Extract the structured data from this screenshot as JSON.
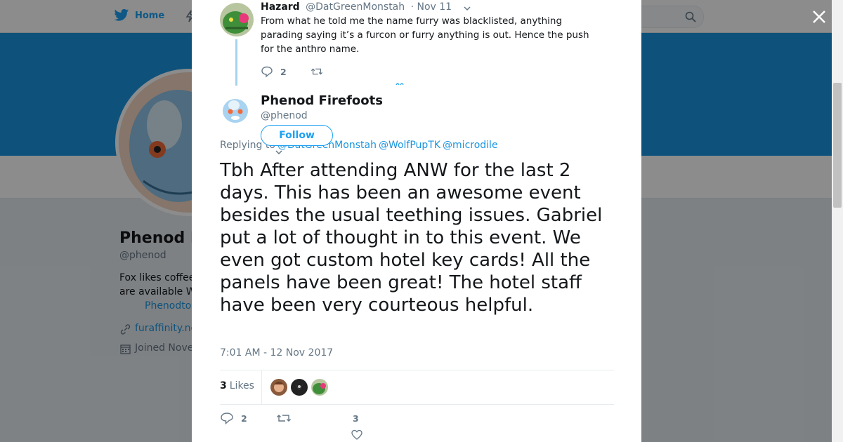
{
  "background": {
    "nav": {
      "home_label": "Home"
    },
    "profile": {
      "name": "Phenod F",
      "handle": "@phenod",
      "bio_line1": "Fox likes coffee",
      "bio_line2": "are available W",
      "bio_link": "Phenodto",
      "url": "furaffinity.ne",
      "joined": "Joined Nove"
    }
  },
  "reply_tweet": {
    "author_name": "Hazard",
    "author_handle": "@DatGreenMonstah",
    "time": "· Nov 11",
    "text": "From what he told me the name furry was blacklisted, anything parading saying it’s a furcon or furry anything is out. Hence the push for the anthro name.",
    "reply_count": "2"
  },
  "main_tweet": {
    "author_name": "Phenod Firefoots",
    "author_handle": "@phenod",
    "follow_label": "Follow",
    "replying_prefix": "Replying to",
    "mentions": [
      "@DatGreenMonstah",
      "@WolfPupTK",
      "@microdile"
    ],
    "text": "Tbh After attending ANW for the last 2 days. This has been an awesome event besides the usual teething issues. Gabriel put a lot of thought in to this event. We even got custom hotel key cards! All the panels have been great! The hotel staff have been very courteous helpful.",
    "timestamp": "7:01 AM - 12 Nov 2017",
    "likes_count": "3",
    "likes_label": "Likes",
    "reply_count": "2",
    "like_count": "3"
  },
  "colors": {
    "brand_blue": "#1da1f2",
    "link_blue": "#1b95e0",
    "banner": "#1b95e0",
    "muted_text": "#657786",
    "thread_line": "#a5d3ee"
  }
}
